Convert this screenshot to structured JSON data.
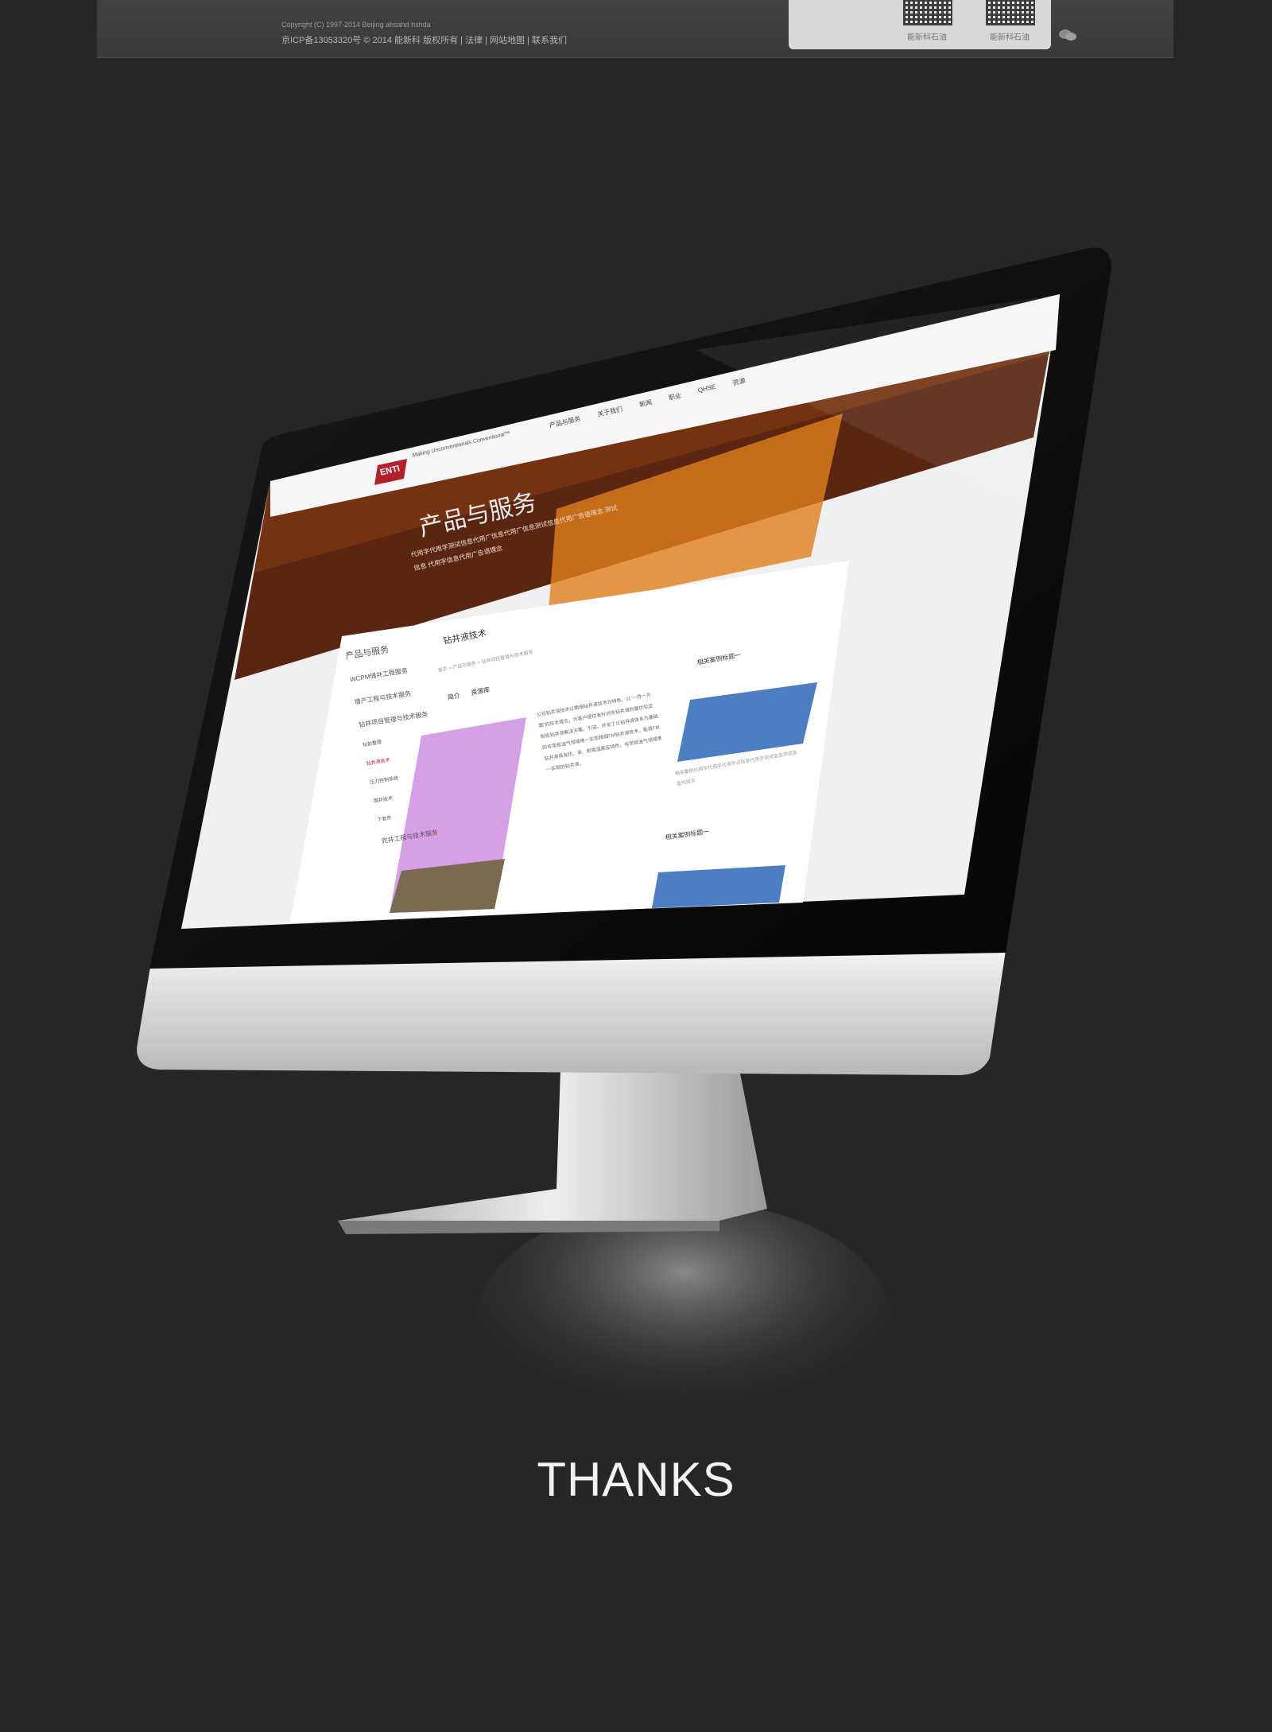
{
  "footer": {
    "copyright_line": "Copyright (C) 1997-2014  Beijing ahsahd  hshda",
    "icp_line": "京ICP备13053320号  © 2014 能新科 版权所有",
    "links": [
      "法律",
      "网站地图",
      "联系我们"
    ],
    "separator": "|",
    "qr_labels": [
      "能新科石油",
      "能新科石油"
    ]
  },
  "site": {
    "logo": "ENTI",
    "tagline": "Making Unconventionals Conventional™",
    "menu": [
      "产品与服务",
      "关于我们",
      "新闻",
      "职业",
      "QHSE",
      "资源"
    ],
    "hero_title": "产品与服务",
    "hero_text": "代用字代用字测试信息代用广信息代用广信息测试信息代用广告语理念 测试信息 代用字信息代用广告语理念",
    "sidebar": [
      "产品与服务",
      "WCPM储井工程服务",
      "增产工程与技术服务",
      "钻井项目管理与技术服务",
      "钻前整理",
      "钻井液技术",
      "压力控制系统",
      "固井技术",
      "下套件",
      "完井工程与技术服务"
    ],
    "active_sidebar_index": 5,
    "page_title": "钻井液技术",
    "breadcrumb": "首页 > 产品与服务 > 钻井项目管理与技术服务",
    "tabs": [
      "简介",
      "资源库"
    ],
    "body_text": "公司钻井液技术以精细钻井液技术为特色，以“一井一方案”的技术理念，为客户提供有针对性钻井液的最优化定制化钻井液解决方案。引进、开发了以钻井液体系为基础的非常规油气领域唯一实现精细TM钻井液技术。能源TM钻井液具有抗、承、耐高温高压特性，非常规油气领域唯一实现的钻井液。",
    "related_title": "相关案例标题一",
    "related_text": "相关案例代用字代用字代用字试信息代用字测试信息测试信息代用字",
    "related_title_2": "相关案例标题一"
  },
  "closing": {
    "thanks": "THANKS"
  }
}
